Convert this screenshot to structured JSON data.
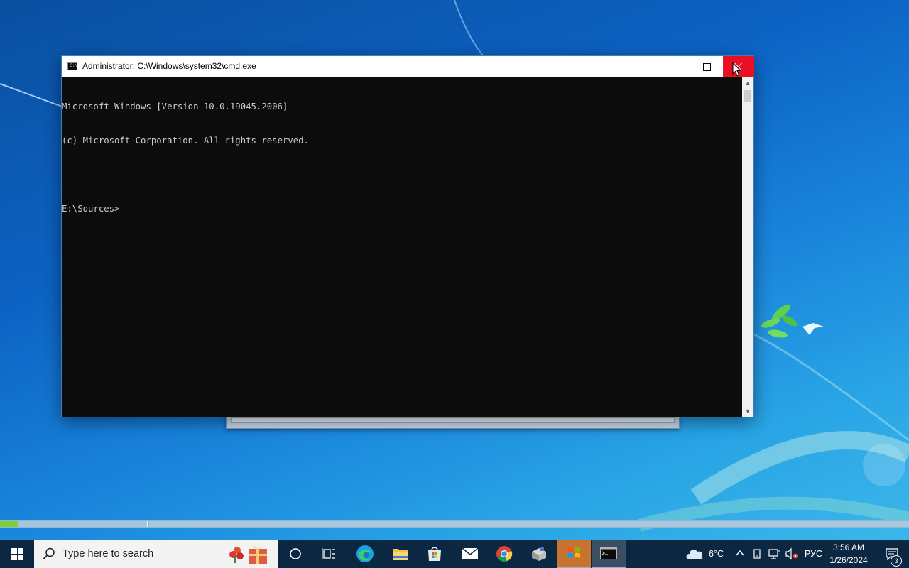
{
  "window": {
    "title": "Administrator: C:\\Windows\\system32\\cmd.exe",
    "icon_text": "C:\\"
  },
  "console": {
    "lines": [
      "Microsoft Windows [Version 10.0.19045.2006]",
      "(c) Microsoft Corporation. All rights reserved.",
      "",
      "E:\\Sources>"
    ]
  },
  "taskbar": {
    "search_placeholder": "Type here to search",
    "pinned_icons": [
      "cortana-icon",
      "task-view-icon",
      "edge-icon",
      "file-explorer-icon",
      "store-icon",
      "mail-icon",
      "chrome-icon",
      "installer-icon",
      "windows-setup-icon",
      "cmd-icon"
    ],
    "weather": {
      "temperature": "6°C",
      "icon": "cloud-icon"
    },
    "language": "РУС",
    "clock": {
      "time": "3:56 AM",
      "date": "1/26/2024"
    },
    "notifications": {
      "count": "3"
    }
  },
  "progress": {
    "value": 0.12
  },
  "colors": {
    "close_button": "#e81123",
    "console_bg": "#0c0c0c",
    "console_text": "#cccccc",
    "taskbar_bg": "#0c2742",
    "progress_fill": "#7bd13a"
  }
}
